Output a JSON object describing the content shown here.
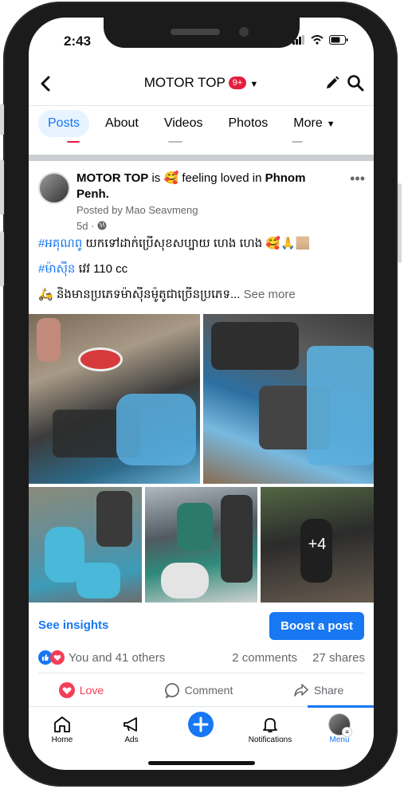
{
  "status_bar": {
    "time": "2:43"
  },
  "header": {
    "title": "MOTOR TOP",
    "badge": "9+"
  },
  "tabs": [
    {
      "label": "Posts",
      "active": true
    },
    {
      "label": "About"
    },
    {
      "label": "Videos"
    },
    {
      "label": "Photos"
    },
    {
      "label": "More"
    }
  ],
  "post": {
    "page_name": "MOTOR TOP",
    "is_word": "is",
    "feeling_emoji": "🥰",
    "feeling_text": "feeling loved in",
    "location": "Phnom Penh.",
    "byline": "Posted by Mao Seavmeng",
    "time": "5d ·",
    "line1_hash": "#អគុណពូ",
    "line1_text": " យកទៅដាក់ប្រើសុខសប្បាយ ហេង ហេង 🥰🙏🏼",
    "line2_hash": "#ម៉ាស៊ីន",
    "line2_text": " វេវ 110 cc",
    "line3_text": "🛵 និងមានប្រភេទម៉ាស៊ីនម៉ូតូជាច្រើនប្រភេទ...",
    "see_more": " See more",
    "extra_photos": "+4"
  },
  "insights": {
    "see_insights": "See insights",
    "boost": "Boost a post"
  },
  "reactions": {
    "summary": "You and 41 others",
    "comments": "2 comments",
    "shares": "27 shares"
  },
  "actions": {
    "love": "Love",
    "comment": "Comment",
    "share": "Share"
  },
  "bottom_nav": [
    {
      "label": "Home",
      "icon": "home-icon"
    },
    {
      "label": "Ads",
      "icon": "megaphone-icon"
    },
    {
      "label": "",
      "icon": "plus-icon"
    },
    {
      "label": "Notifications",
      "icon": "bell-icon"
    },
    {
      "label": "Menu",
      "icon": "avatar",
      "active": true
    }
  ],
  "colors": {
    "accent": "#1877f2",
    "love": "#f33e58",
    "badge": "#e41e3f"
  }
}
